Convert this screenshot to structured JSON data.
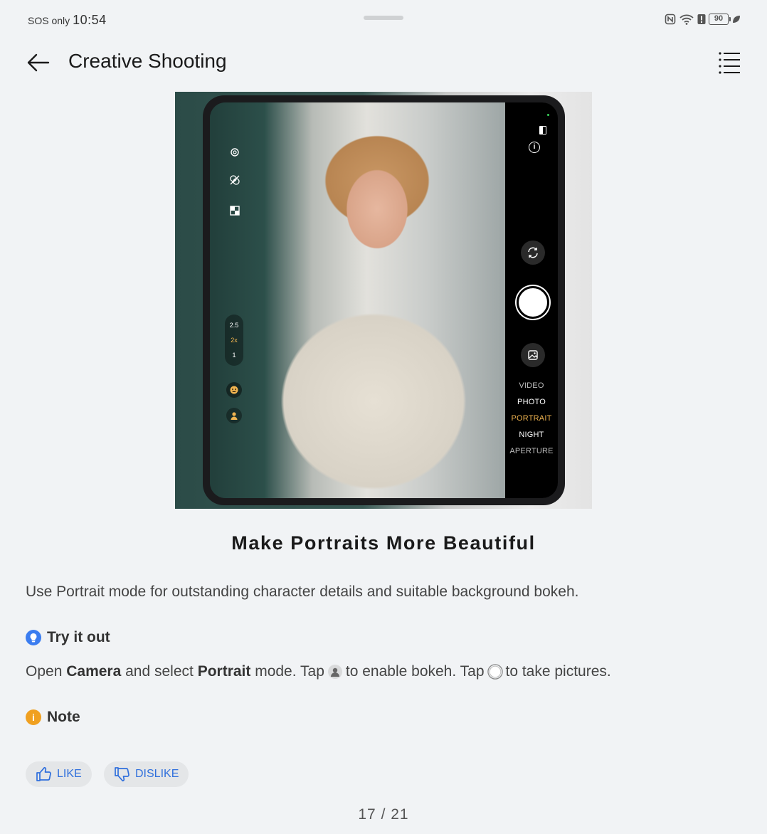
{
  "status_bar": {
    "carrier": "SOS only",
    "time": "10:54",
    "battery": "90",
    "icons": [
      "nfc-icon",
      "wifi-icon",
      "alert-icon",
      "battery-icon",
      "leaf-icon"
    ]
  },
  "app_bar": {
    "title": "Creative Shooting",
    "back_icon": "back-arrow-icon",
    "menu_icon": "menu-list-icon"
  },
  "camera_preview": {
    "zoom_levels": [
      "2.5",
      "2x",
      "1"
    ],
    "active_zoom": "2x",
    "modes": [
      "VIDEO",
      "PHOTO",
      "PORTRAIT",
      "NIGHT",
      "APERTURE"
    ],
    "active_mode": "PORTRAIT",
    "side_icons": [
      "settings-icon",
      "filter-off-icon",
      "aspect-ratio-icon",
      "beauty-icon",
      "bokeh-icon"
    ]
  },
  "article": {
    "headline": "Make Portraits More Beautiful",
    "description": "Use Portrait mode for outstanding character details and suitable background bokeh.",
    "tip_heading": "Try it out",
    "steps": {
      "p1": "Open ",
      "camera": "Camera",
      "p2": " and select ",
      "portrait": "Portrait",
      "p3": " mode. Tap",
      "p4": "to enable bokeh. Tap",
      "p5": "to take pictures."
    },
    "note_heading": "Note"
  },
  "feedback": {
    "like": "LIKE",
    "dislike": "DISLIKE"
  },
  "pager": "17 / 21",
  "colors": {
    "accent": "#2f6fdc",
    "tip": "#3b7df0",
    "note": "#f0a020",
    "mode_active": "#f0b450"
  }
}
